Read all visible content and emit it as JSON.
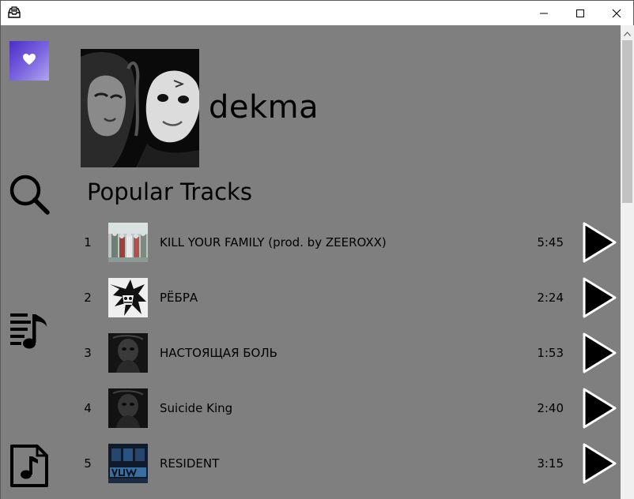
{
  "window": {
    "app_icon": "inbox-tray-icon",
    "controls": [
      "minimize-icon",
      "maximize-icon",
      "close-icon"
    ]
  },
  "sidebar": {
    "items": [
      {
        "name": "favorites",
        "icon": "heart-icon",
        "accent": "#5a3fd4"
      },
      {
        "name": "search",
        "icon": "search-icon"
      },
      {
        "name": "playlist",
        "icon": "playlist-icon"
      },
      {
        "name": "local-files",
        "icon": "music-file-icon"
      }
    ]
  },
  "artist": {
    "name": "dekma"
  },
  "popular": {
    "title": "Popular Tracks",
    "tracks": [
      {
        "num": "1",
        "title": "KILL YOUR FAMILY (prod. by ZEEROXX)",
        "duration": "5:45"
      },
      {
        "num": "2",
        "title": "РЁБРА",
        "duration": "2:24"
      },
      {
        "num": "3",
        "title": "НАСТОЯЩАЯ БОЛЬ",
        "duration": "1:53"
      },
      {
        "num": "4",
        "title": "Suicide King",
        "duration": "2:40"
      },
      {
        "num": "5",
        "title": "RESIDENT",
        "duration": "3:15"
      }
    ]
  },
  "colors": {
    "background": "#7f7f7f",
    "titlebar": "#ffffff",
    "scrollbar_track": "#f0f0f0",
    "scrollbar_thumb": "#c2c2c2"
  }
}
